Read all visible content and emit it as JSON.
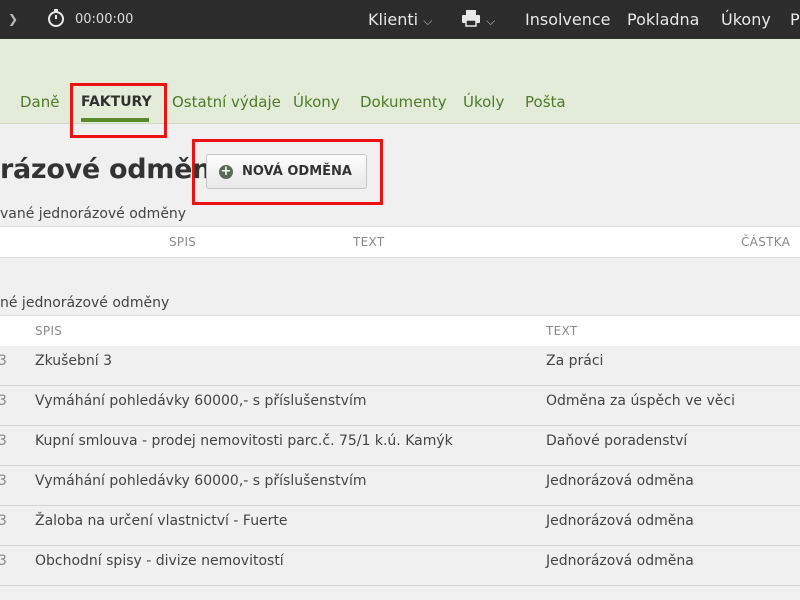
{
  "topbar": {
    "timer": "00:00:00",
    "clients_label": "Klienti",
    "insolvence_label": "Insolvence",
    "pokladna_label": "Pokladna",
    "ukony_label": "Úkony",
    "cut_label": "P"
  },
  "tabs": [
    "Daně",
    "FAKTURY",
    "Ostatní výdaje",
    "Úkony",
    "Dokumenty",
    "Úkoly",
    "Pošta"
  ],
  "active_tab": "FAKTURY",
  "page_title": "rázové odměny",
  "new_button_label": "NOVÁ ODMĚNA",
  "section1": {
    "label": "vané jednorázové odměny",
    "columns": [
      "SPIS",
      "TEXT",
      "ČÁSTKA"
    ]
  },
  "section2": {
    "label": "né jednorázové odměny",
    "columns": [
      "SPIS",
      "TEXT"
    ],
    "rows": [
      {
        "num": "3",
        "spis": "Zkušební 3",
        "text": "Za práci"
      },
      {
        "num": "3",
        "spis": "Vymáhání pohledávky 60000,- s příslušenstvím",
        "text": "Odměna za úspěch ve věci"
      },
      {
        "num": "3",
        "spis": "Kupní smlouva - prodej nemovitosti parc.č. 75/1 k.ú. Kamýk",
        "text": "Daňové poradenství"
      },
      {
        "num": "3",
        "spis": "Vymáhání pohledávky 60000,- s příslušenstvím",
        "text": "Jednorázová odměna"
      },
      {
        "num": "3",
        "spis": "Žaloba na určení vlastnictví - Fuerte",
        "text": "Jednorázová odměna"
      },
      {
        "num": "3",
        "spis": "Obchodní spisy - divize nemovitostí",
        "text": "Jednorázová odměna"
      }
    ]
  },
  "colors": {
    "highlight": "#ee1111",
    "accent": "#5a8a2a",
    "header_bg": "#e3ecd8",
    "topbar_bg": "#2c2c2c"
  }
}
